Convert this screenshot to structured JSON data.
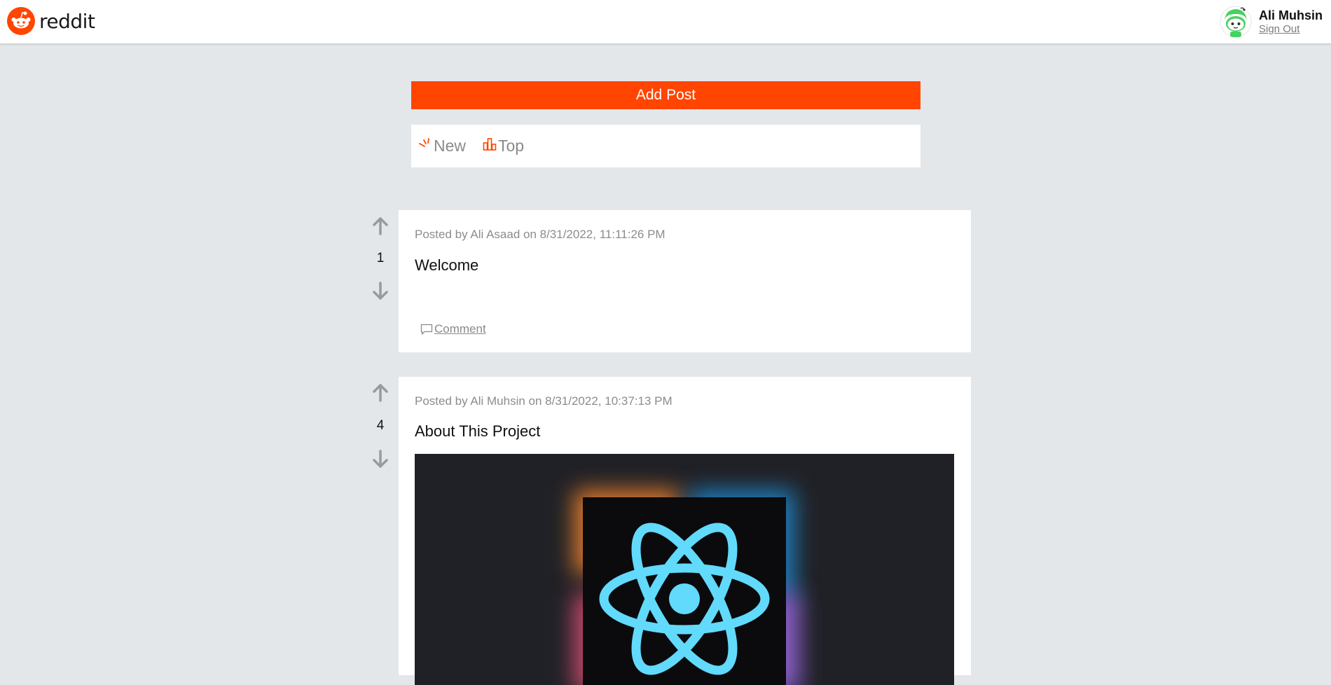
{
  "header": {
    "logo_text": "reddit",
    "user_name": "Ali Muhsin",
    "sign_out_label": "Sign Out"
  },
  "toolbar": {
    "add_post_label": "Add Post",
    "sort": {
      "new_label": "New",
      "top_label": "Top"
    }
  },
  "colors": {
    "brand": "#ff4500",
    "page_bg": "#e4e7ea",
    "muted_text": "#8c8c8c"
  },
  "posts": [
    {
      "meta": "Posted by Ali Asaad on 8/31/2022, 11:11:26 PM",
      "title": "Welcome",
      "score": "1",
      "comment_label": "Comment"
    },
    {
      "meta": "Posted by Ali Muhsin on 8/31/2022, 10:37:13 PM",
      "title": "About This Project",
      "score": "4",
      "image": "react-logo-image"
    }
  ],
  "icons": {
    "upvote": "arrow-up-icon",
    "downvote": "arrow-down-icon",
    "new": "sparkle-icon",
    "top": "bar-chart-icon",
    "comment": "speech-bubble-icon"
  }
}
